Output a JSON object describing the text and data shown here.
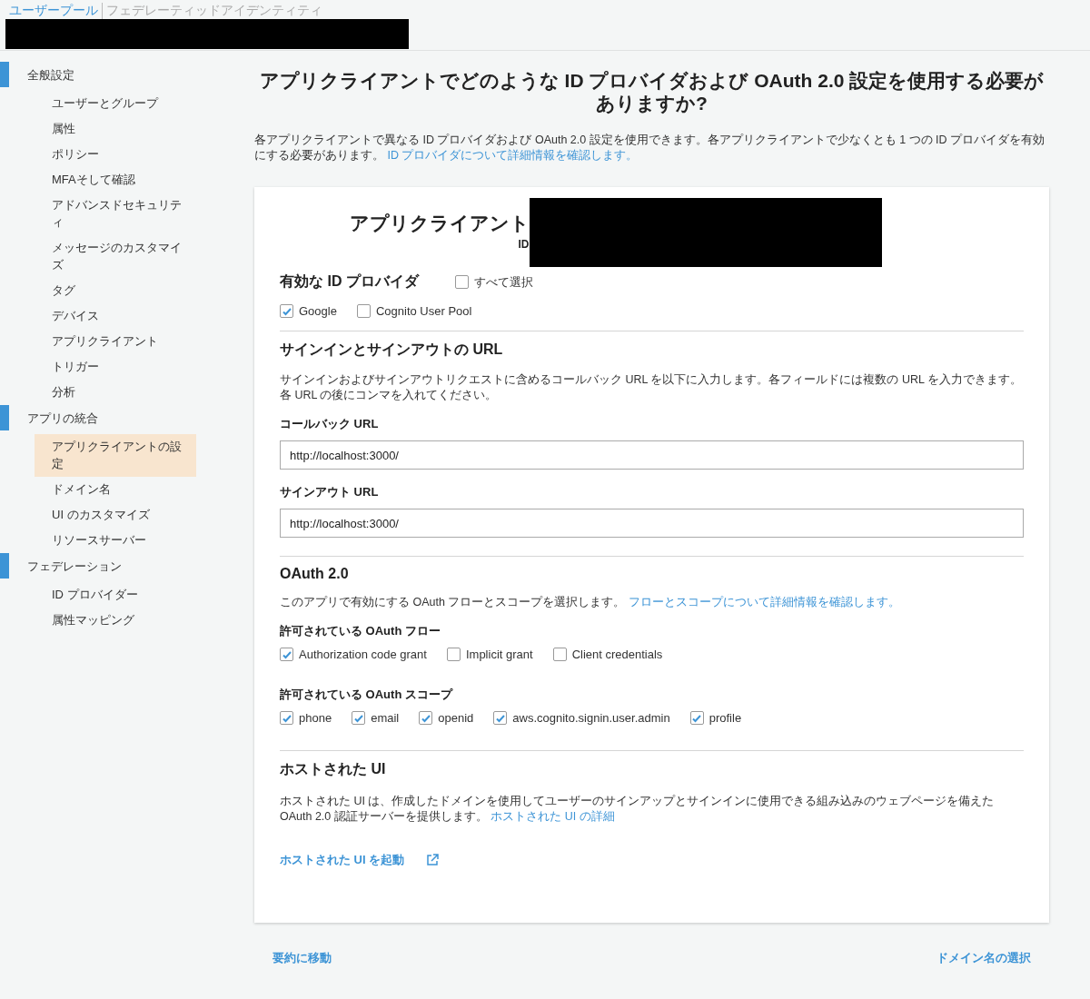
{
  "header": {
    "tabs": [
      {
        "label": "ユーザープール",
        "selected": true
      },
      {
        "label": "フェデレーティッドアイデンティティ",
        "selected": false
      }
    ]
  },
  "sidebar": {
    "sections": [
      {
        "label": "全般設定",
        "items": [
          {
            "label": "ユーザーとグループ",
            "selected": false
          },
          {
            "label": "属性",
            "selected": false
          },
          {
            "label": "ポリシー",
            "selected": false
          },
          {
            "label": "MFAそして確認",
            "selected": false
          },
          {
            "label": "アドバンスドセキュリティ",
            "selected": false
          },
          {
            "label": "メッセージのカスタマイズ",
            "selected": false
          },
          {
            "label": "タグ",
            "selected": false
          },
          {
            "label": "デバイス",
            "selected": false
          },
          {
            "label": "アプリクライアント",
            "selected": false
          },
          {
            "label": "トリガー",
            "selected": false
          },
          {
            "label": "分析",
            "selected": false
          }
        ]
      },
      {
        "label": "アプリの統合",
        "items": [
          {
            "label": "アプリクライアントの設定",
            "selected": true
          },
          {
            "label": "ドメイン名",
            "selected": false
          },
          {
            "label": "UI のカスタマイズ",
            "selected": false
          },
          {
            "label": "リソースサーバー",
            "selected": false
          }
        ]
      },
      {
        "label": "フェデレーション",
        "items": [
          {
            "label": "ID プロバイダー",
            "selected": false
          },
          {
            "label": "属性マッピング",
            "selected": false
          }
        ]
      }
    ]
  },
  "main": {
    "title": "アプリクライアントでどのような ID プロバイダおよび OAuth 2.0 設定を使用する必要がありますか?",
    "intro": "各アプリクライアントで異なる ID プロバイダおよび OAuth 2.0 設定を使用できます。各アプリクライアントで少なくとも 1 つの ID プロバイダを有効にする必要があります。",
    "intro_link": "ID プロバイダについて詳細情報を確認します。"
  },
  "card": {
    "client_title": "アプリクライアント",
    "client_id_label": "ID",
    "providers": {
      "title": "有効な ID プロバイダ",
      "select_all": {
        "label": "すべて選択",
        "checked": false
      },
      "options": [
        {
          "label": "Google",
          "checked": true
        },
        {
          "label": "Cognito User Pool",
          "checked": false
        }
      ]
    },
    "urls": {
      "title": "サインインとサインアウトの URL",
      "description": "サインインおよびサインアウトリクエストに含めるコールバック URL を以下に入力します。各フィールドには複数の URL を入力できます。各 URL の後にコンマを入れてください。",
      "fields": [
        {
          "label": "コールバック URL",
          "value": "http://localhost:3000/"
        },
        {
          "label": "サインアウト URL",
          "value": "http://localhost:3000/"
        }
      ]
    },
    "oauth": {
      "title": "OAuth 2.0",
      "description": "このアプリで有効にする OAuth フローとスコープを選択します。",
      "link": "フローとスコープについて詳細情報を確認します。",
      "groups": [
        {
          "title": "許可されている OAuth フロー",
          "options": [
            {
              "label": "Authorization code grant",
              "checked": true
            },
            {
              "label": "Implicit grant",
              "checked": false
            },
            {
              "label": "Client credentials",
              "checked": false
            }
          ]
        },
        {
          "title": "許可されている OAuth スコープ",
          "options": [
            {
              "label": "phone",
              "checked": true
            },
            {
              "label": "email",
              "checked": true
            },
            {
              "label": "openid",
              "checked": true
            },
            {
              "label": "aws.cognito.signin.user.admin",
              "checked": true
            },
            {
              "label": "profile",
              "checked": true
            }
          ]
        }
      ]
    },
    "hosted_ui": {
      "title": "ホストされた UI",
      "description": "ホストされた UI は、作成したドメインを使用してユーザーのサインアップとサインインに使用できる組み込みのウェブページを備えた OAuth 2.0 認証サーバーを提供します。",
      "link": "ホストされた UI の詳細",
      "launch": "ホストされた UI を起動"
    }
  },
  "footer": {
    "back": "要約に移動",
    "next": "ドメイン名の選択"
  }
}
